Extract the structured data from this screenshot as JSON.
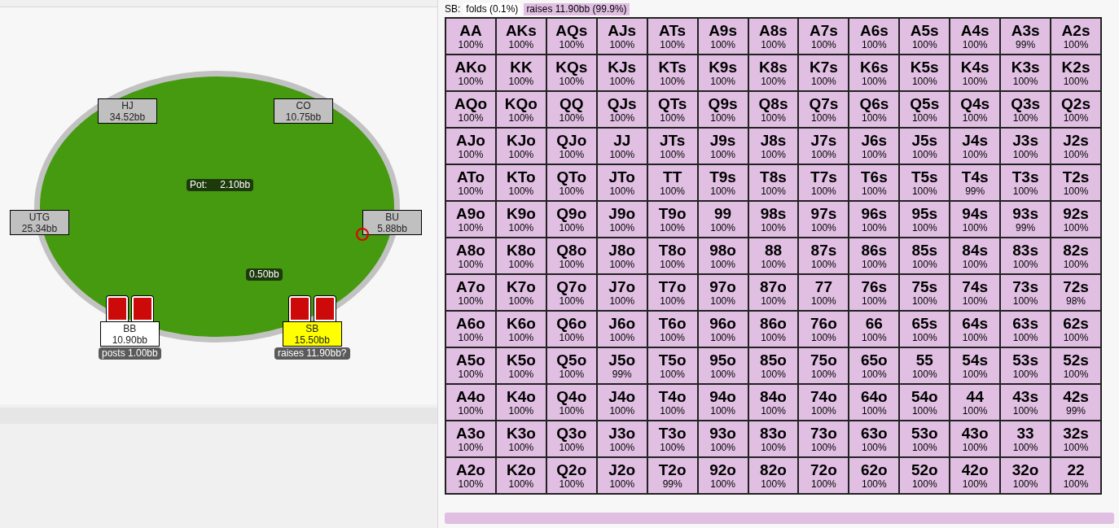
{
  "table": {
    "pot": {
      "label": "Pot:",
      "value": "2.10bb"
    },
    "bet": "0.50bb",
    "seats": [
      {
        "position": "HJ",
        "stack": "34.52bb",
        "kind": "idle",
        "cards": false,
        "dealer": false
      },
      {
        "position": "CO",
        "stack": "10.75bb",
        "kind": "idle",
        "cards": false,
        "dealer": false
      },
      {
        "position": "UTG",
        "stack": "25.34bb",
        "kind": "idle",
        "cards": false,
        "dealer": false
      },
      {
        "position": "BU",
        "stack": "5.88bb",
        "kind": "idle",
        "cards": false,
        "dealer": true
      },
      {
        "position": "BB",
        "stack": "10.90bb",
        "kind": "waiting",
        "cards": true,
        "dealer": false,
        "action": "posts 1.00bb"
      },
      {
        "position": "SB",
        "stack": "15.50bb",
        "kind": "acting",
        "cards": true,
        "dealer": false,
        "action": "raises 11.90bb?"
      }
    ]
  },
  "range": {
    "player": "SB:",
    "actions": [
      {
        "label": "folds (0.1%)",
        "selected": false
      },
      {
        "label": "raises 11.90bb (99.9%)",
        "selected": true
      }
    ],
    "rows": [
      [
        "AA 100%",
        "AKs 100%",
        "AQs 100%",
        "AJs 100%",
        "ATs 100%",
        "A9s 100%",
        "A8s 100%",
        "A7s 100%",
        "A6s 100%",
        "A5s 100%",
        "A4s 100%",
        "A3s 99%",
        "A2s 100%"
      ],
      [
        "AKo 100%",
        "KK 100%",
        "KQs 100%",
        "KJs 100%",
        "KTs 100%",
        "K9s 100%",
        "K8s 100%",
        "K7s 100%",
        "K6s 100%",
        "K5s 100%",
        "K4s 100%",
        "K3s 100%",
        "K2s 100%"
      ],
      [
        "AQo 100%",
        "KQo 100%",
        "QQ 100%",
        "QJs 100%",
        "QTs 100%",
        "Q9s 100%",
        "Q8s 100%",
        "Q7s 100%",
        "Q6s 100%",
        "Q5s 100%",
        "Q4s 100%",
        "Q3s 100%",
        "Q2s 100%"
      ],
      [
        "AJo 100%",
        "KJo 100%",
        "QJo 100%",
        "JJ 100%",
        "JTs 100%",
        "J9s 100%",
        "J8s 100%",
        "J7s 100%",
        "J6s 100%",
        "J5s 100%",
        "J4s 100%",
        "J3s 100%",
        "J2s 100%"
      ],
      [
        "ATo 100%",
        "KTo 100%",
        "QTo 100%",
        "JTo 100%",
        "TT 100%",
        "T9s 100%",
        "T8s 100%",
        "T7s 100%",
        "T6s 100%",
        "T5s 100%",
        "T4s 99%",
        "T3s 100%",
        "T2s 100%"
      ],
      [
        "A9o 100%",
        "K9o 100%",
        "Q9o 100%",
        "J9o 100%",
        "T9o 100%",
        "99 100%",
        "98s 100%",
        "97s 100%",
        "96s 100%",
        "95s 100%",
        "94s 100%",
        "93s 99%",
        "92s 100%"
      ],
      [
        "A8o 100%",
        "K8o 100%",
        "Q8o 100%",
        "J8o 100%",
        "T8o 100%",
        "98o 100%",
        "88 100%",
        "87s 100%",
        "86s 100%",
        "85s 100%",
        "84s 100%",
        "83s 100%",
        "82s 100%"
      ],
      [
        "A7o 100%",
        "K7o 100%",
        "Q7o 100%",
        "J7o 100%",
        "T7o 100%",
        "97o 100%",
        "87o 100%",
        "77 100%",
        "76s 100%",
        "75s 100%",
        "74s 100%",
        "73s 100%",
        "72s 98%"
      ],
      [
        "A6o 100%",
        "K6o 100%",
        "Q6o 100%",
        "J6o 100%",
        "T6o 100%",
        "96o 100%",
        "86o 100%",
        "76o 100%",
        "66 100%",
        "65s 100%",
        "64s 100%",
        "63s 100%",
        "62s 100%"
      ],
      [
        "A5o 100%",
        "K5o 100%",
        "Q5o 100%",
        "J5o 99%",
        "T5o 100%",
        "95o 100%",
        "85o 100%",
        "75o 100%",
        "65o 100%",
        "55 100%",
        "54s 100%",
        "53s 100%",
        "52s 100%"
      ],
      [
        "A4o 100%",
        "K4o 100%",
        "Q4o 100%",
        "J4o 100%",
        "T4o 100%",
        "94o 100%",
        "84o 100%",
        "74o 100%",
        "64o 100%",
        "54o 100%",
        "44 100%",
        "43s 100%",
        "42s 99%"
      ],
      [
        "A3o 100%",
        "K3o 100%",
        "Q3o 100%",
        "J3o 100%",
        "T3o 100%",
        "93o 100%",
        "83o 100%",
        "73o 100%",
        "63o 100%",
        "53o 100%",
        "43o 100%",
        "33 100%",
        "32s 100%"
      ],
      [
        "A2o 100%",
        "K2o 100%",
        "Q2o 100%",
        "J2o 100%",
        "T2o 99%",
        "92o 100%",
        "82o 100%",
        "72o 100%",
        "62o 100%",
        "52o 100%",
        "42o 100%",
        "32o 100%",
        "22 100%"
      ]
    ]
  }
}
